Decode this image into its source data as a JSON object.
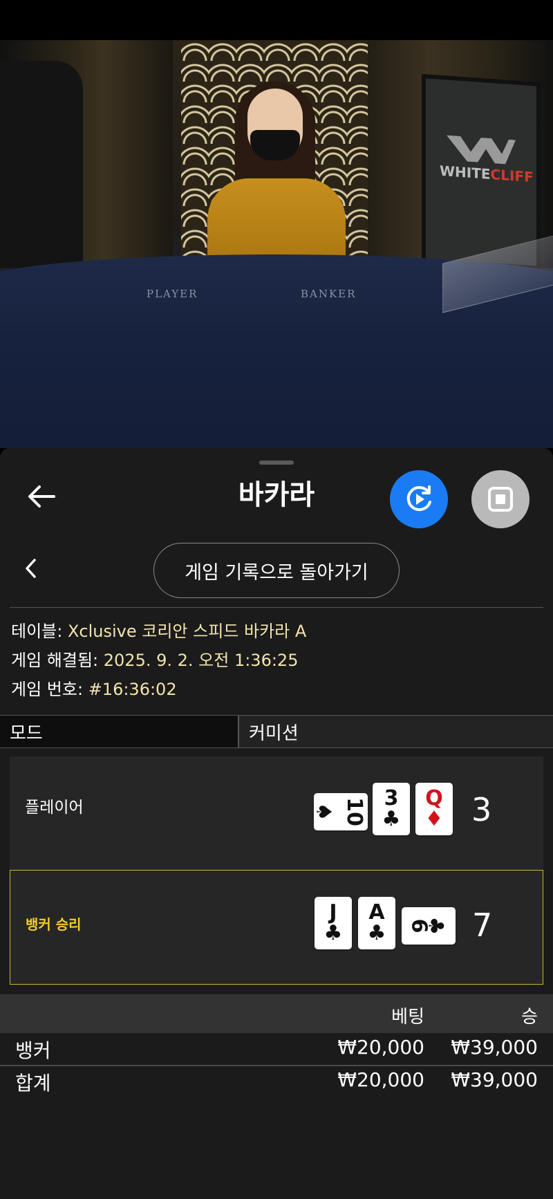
{
  "video": {
    "player_felt_label": "PLAYER",
    "banker_felt_label": "BANKER",
    "monitor_logo_white": "WHITE",
    "monitor_logo_red": "CLIFF"
  },
  "header": {
    "title": "바카라",
    "back_icon": "arrow-left-icon",
    "replay_icon": "replay-icon",
    "stop_icon": "stop-icon"
  },
  "history": {
    "back_label": "게임 기록으로 돌아가기"
  },
  "info": {
    "table_label": "테이블:",
    "table_value": "Xclusive 코리안 스피드 바카라 A",
    "resolved_label": "게임 해결됨:",
    "resolved_value": "2025. 9. 2. 오전 1:36:25",
    "number_label": "게임 번호:",
    "number_value": "#16:36:02"
  },
  "tabs": {
    "mode": "모드",
    "commission": "커미션"
  },
  "hands": {
    "player": {
      "label": "플레이어",
      "score": "3",
      "cards": [
        {
          "rank": "10",
          "suit": "♠",
          "color": "#111111"
        },
        {
          "rank": "3",
          "suit": "♣",
          "color": "#111111"
        },
        {
          "rank": "Q",
          "suit": "♦",
          "color": "#d0141a"
        }
      ]
    },
    "banker": {
      "label": "뱅커 승리",
      "score": "7",
      "cards": [
        {
          "rank": "J",
          "suit": "♣",
          "color": "#111111"
        },
        {
          "rank": "A",
          "suit": "♣",
          "color": "#111111"
        },
        {
          "rank": "6",
          "suit": "♣",
          "color": "#111111"
        }
      ]
    }
  },
  "bets": {
    "col_bet": "베팅",
    "col_win": "승",
    "rows": [
      {
        "name": "뱅커",
        "bet": "₩20,000",
        "win": "₩39,000"
      },
      {
        "name": "합계",
        "bet": "₩20,000",
        "win": "₩39,000"
      }
    ]
  },
  "colors": {
    "accent_blue": "#1a7cf5",
    "winner_gold": "#f4cd2a",
    "info_value": "#f3e4ad"
  }
}
